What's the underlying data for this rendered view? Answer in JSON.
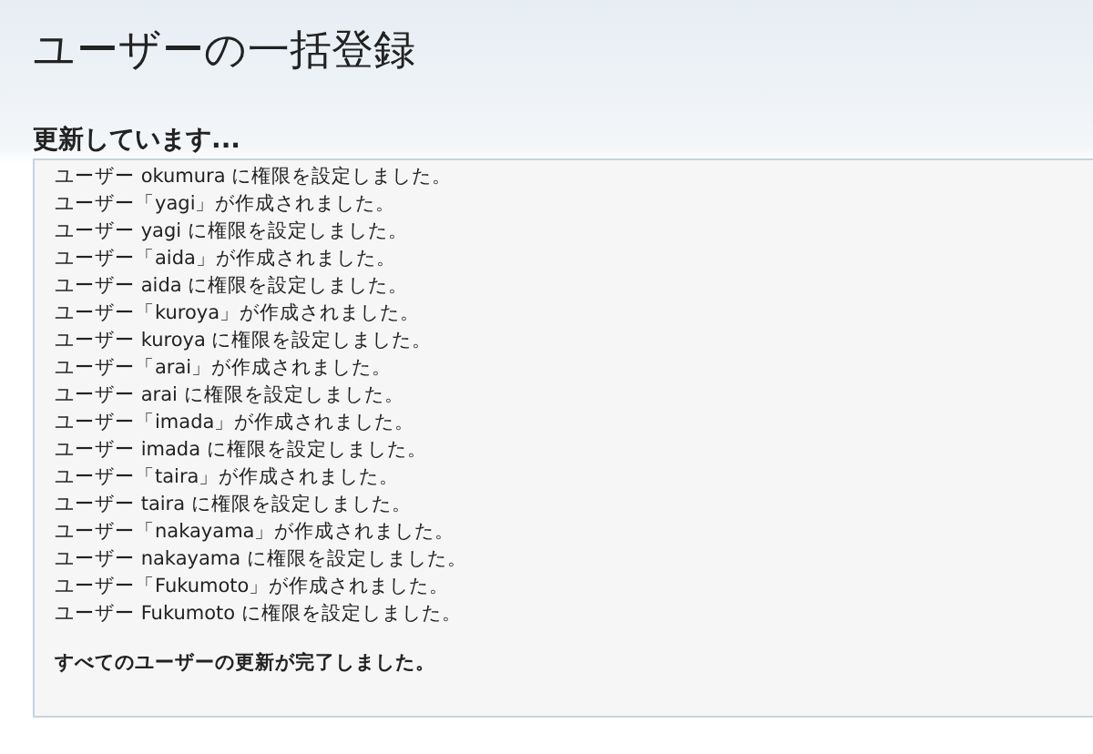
{
  "page": {
    "title": "ユーザーの一括登録"
  },
  "section": {
    "heading": "更新しています..."
  },
  "log": {
    "lines": [
      "ユーザー okumura に権限を設定しました。",
      "ユーザー「yagi」が作成されました。",
      "ユーザー yagi に権限を設定しました。",
      "ユーザー「aida」が作成されました。",
      "ユーザー aida に権限を設定しました。",
      "ユーザー「kuroya」が作成されました。",
      "ユーザー kuroya に権限を設定しました。",
      "ユーザー「arai」が作成されました。",
      "ユーザー arai に権限を設定しました。",
      "ユーザー「imada」が作成されました。",
      "ユーザー imada に権限を設定しました。",
      "ユーザー「taira」が作成されました。",
      "ユーザー taira に権限を設定しました。",
      "ユーザー「nakayama」が作成されました。",
      "ユーザー nakayama に権限を設定しました。",
      "ユーザー「Fukumoto」が作成されました。",
      "ユーザー Fukumoto に権限を設定しました。"
    ],
    "completion": "すべてのユーザーの更新が完了しました。"
  }
}
